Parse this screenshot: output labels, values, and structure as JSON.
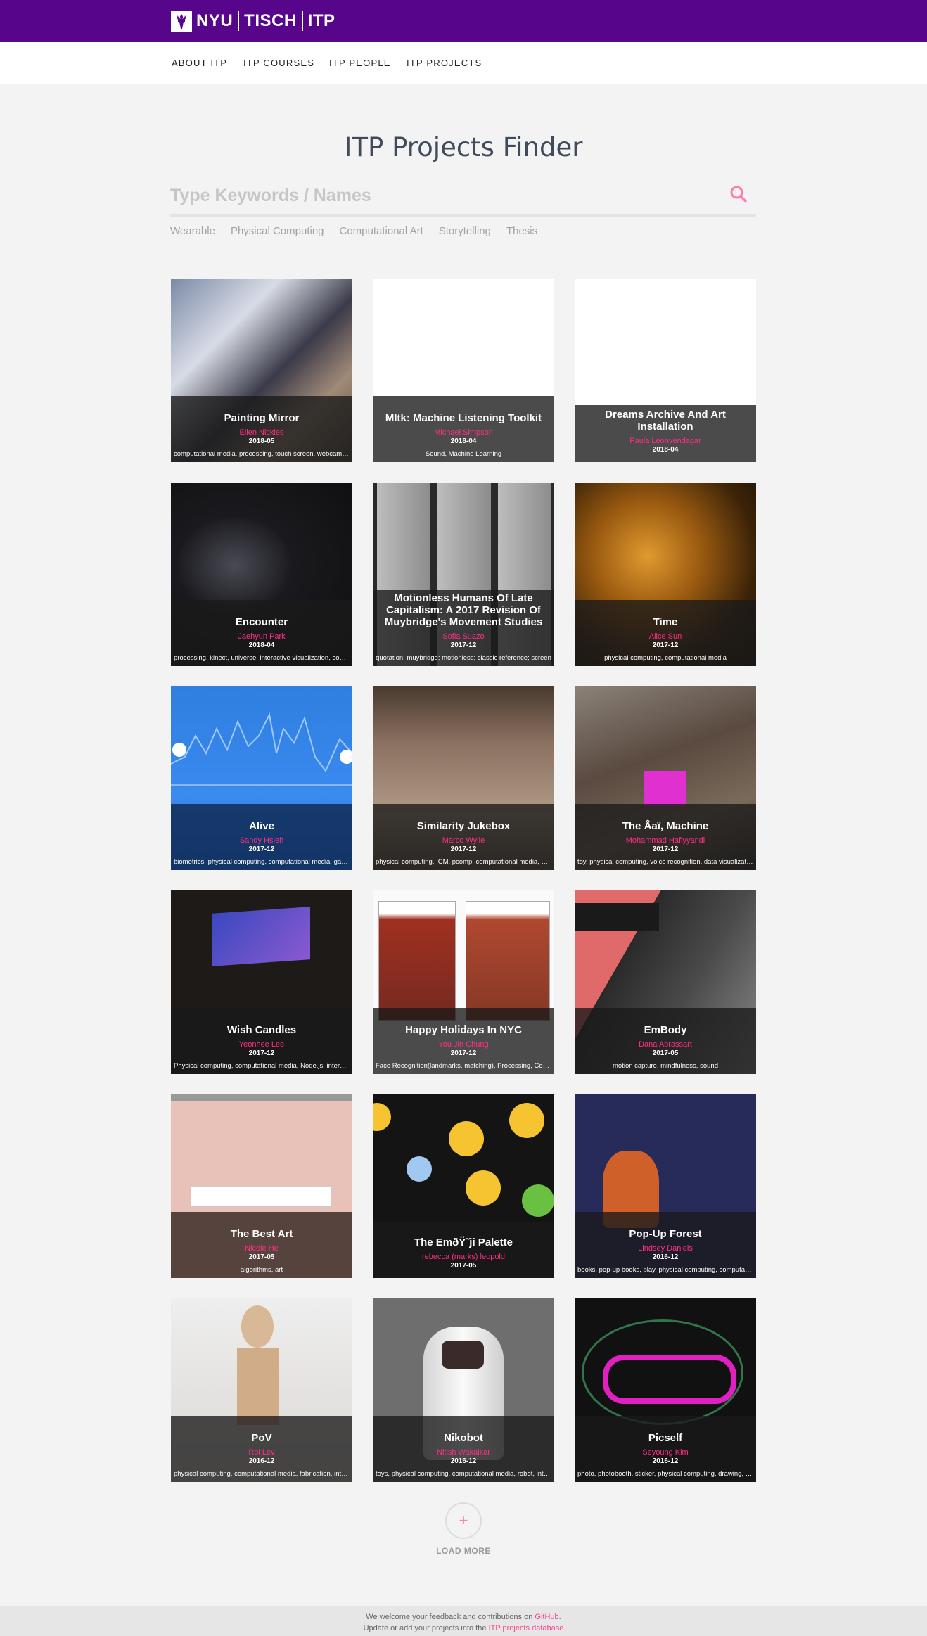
{
  "brand": {
    "nyu": "NYU",
    "tisch": "TISCH",
    "itp": "ITP"
  },
  "nav": [
    "ABOUT ITP",
    "ITP COURSES",
    "ITP PEOPLE",
    "ITP PROJECTS"
  ],
  "page_title": "ITP Projects Finder",
  "search": {
    "placeholder": "Type Keywords / Names",
    "value": ""
  },
  "filters": [
    "Wearable",
    "Physical Computing",
    "Computational Art",
    "Storytelling",
    "Thesis"
  ],
  "projects": [
    {
      "title": "Painting Mirror",
      "author": "Ellen Nickles",
      "date": "2018-05",
      "tags": "computational media, processing, touch screen, webcam, mirror"
    },
    {
      "title": "Mltk: Machine Listening Toolkit",
      "author": "Michael Simpson",
      "date": "2018-04",
      "tags": "Sound, Machine Learning"
    },
    {
      "title": "Dreams Archive And Art Installation",
      "author": "Paula Leonvendagar",
      "date": "2018-04",
      "tags": ""
    },
    {
      "title": "Encounter",
      "author": "Jaehyun Park",
      "date": "2018-04",
      "tags": "processing, kinect, universe, interactive visualization, computational media"
    },
    {
      "title": "Motionless Humans Of Late Capitalism: A 2017 Revision Of Muybridge's Movement Studies",
      "author": "Sofia Suazo",
      "date": "2017-12",
      "tags": "quotation; muybridge; motionless; classic reference; screen"
    },
    {
      "title": "Time",
      "author": "Alice Sun",
      "date": "2017-12",
      "tags": "physical computing, computational media"
    },
    {
      "title": "Alive",
      "author": "Sandy Hsieh",
      "date": "2017-12",
      "tags": "biometrics, physical computing, computational media, game"
    },
    {
      "title": "Similarity Jukebox",
      "author": "Marco Wylie",
      "date": "2017-12",
      "tags": "physical computing, ICM, pcomp, computational media, music"
    },
    {
      "title": "The Âaï, Machine",
      "author": "Mohammad Hafiyyandi",
      "date": "2017-12",
      "tags": "toy, physical computing, voice recognition, data visualization"
    },
    {
      "title": "Wish Candles",
      "author": "Yeonhee Lee",
      "date": "2017-12",
      "tags": "Physical computing, computational media, Node.js, interactive"
    },
    {
      "title": "Happy Holidays In NYC",
      "author": "You Jin Chung",
      "date": "2017-12",
      "tags": "Face Recognition(landmarks, matching), Processing, Computational media"
    },
    {
      "title": "EmBody",
      "author": "Dana Abrassart",
      "date": "2017-05",
      "tags": "motion capture, mindfulness, sound"
    },
    {
      "title": "The Best Art",
      "author": "Nicole He",
      "date": "2017-05",
      "tags": "algorithms, art"
    },
    {
      "title": "The EmðŸ˜ji Palette",
      "author": "rebecca (marks) leopold",
      "date": "2017-05",
      "tags": ""
    },
    {
      "title": "Pop-Up Forest",
      "author": "Lindsey Daniels",
      "date": "2016-12",
      "tags": "books, pop-up books, play, physical computing, computational media"
    },
    {
      "title": "PoV",
      "author": "Roi Lev",
      "date": "2016-12",
      "tags": "physical computing, computational media, fabrication, interactive"
    },
    {
      "title": "Nikobot",
      "author": "Nitish Wakalkar",
      "date": "2016-12",
      "tags": "toys, physical computing, computational media, robot, interaction"
    },
    {
      "title": "Picself",
      "author": "Seyoung Kim",
      "date": "2016-12",
      "tags": "photo, photobooth, sticker, physical computing, drawing, computational media"
    }
  ],
  "load_more": {
    "symbol": "+",
    "label": "LOAD MORE"
  },
  "footer": {
    "line1_text": "We welcome your feedback and contributions on ",
    "line1_link": "GitHub",
    "line1_end": ".",
    "line2_text": "Update or add your projects into the ",
    "line2_link": "ITP projects database"
  },
  "colors": {
    "brand_purple": "#57068c",
    "accent_pink": "#ff2e83"
  }
}
